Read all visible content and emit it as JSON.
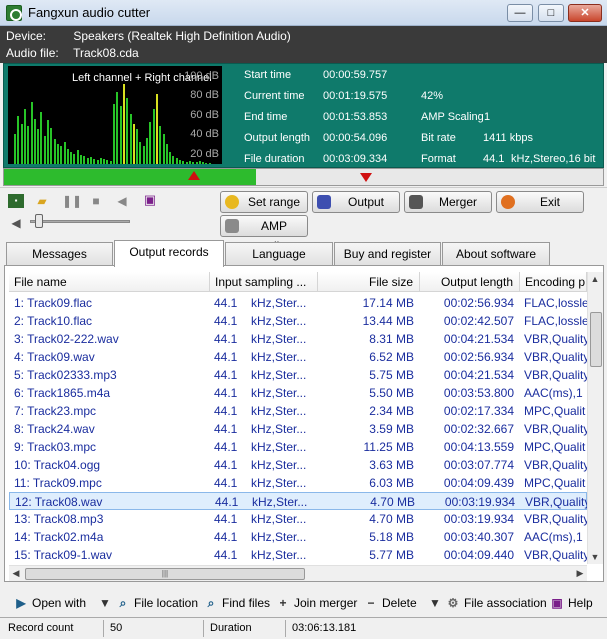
{
  "window": {
    "title": "Fangxun audio cutter",
    "minimize": "—",
    "maximize": "□",
    "close": "✕"
  },
  "info": {
    "device_label": "Device:",
    "device_value": "Speakers (Realtek High Definition Audio)",
    "file_label": "Audio file:",
    "file_value": "Track08.cda"
  },
  "viz": {
    "channel_label": "Left channel + Right channel",
    "db_ticks": [
      "100 dB",
      "80 dB",
      "60 dB",
      "40 dB",
      "20 dB"
    ]
  },
  "stats": {
    "start_time_label": "Start time",
    "start_time": "00:00:59.757",
    "current_time_label": "Current time",
    "current_time": "00:01:19.575",
    "percent": "42%",
    "end_time_label": "End time",
    "end_time": "00:01:53.853",
    "amp_scaling_label": "AMP Scaling",
    "amp_scaling": "1",
    "output_length_label": "Output length",
    "output_length": "00:00:54.096",
    "bit_rate_label": "Bit rate",
    "bit_rate": "1411 kbps",
    "file_duration_label": "File duration",
    "file_duration": "00:03:09.334",
    "format_label": "Format",
    "format_rate": "44.1",
    "format_detail": "kHz,Stereo,16 bit"
  },
  "progress": {
    "fraction": 0.42
  },
  "toolbar": {
    "volume": 0.05,
    "set_range": "Set range",
    "output": "Output",
    "merger": "Merger",
    "exit": "Exit",
    "amp_scaling": "AMP scaling"
  },
  "tabs": [
    {
      "label": "Messages"
    },
    {
      "label": "Output records"
    },
    {
      "label": "Language"
    },
    {
      "label": "Buy and register"
    },
    {
      "label": "About software"
    }
  ],
  "columns": [
    "File name",
    "Input sampling ...",
    "File size",
    "Output length",
    "Encoding p"
  ],
  "rows": [
    [
      "1: Track09.flac",
      "44.1",
      "kHz,Ster...",
      "17.14 MB",
      "00:02:56.934",
      "FLAC,lossle"
    ],
    [
      "2: Track10.flac",
      "44.1",
      "kHz,Ster...",
      "13.44 MB",
      "00:02:42.507",
      "FLAC,lossle"
    ],
    [
      "3: Track02-222.wav",
      "44.1",
      "kHz,Ster...",
      "8.31 MB",
      "00:04:21.534",
      "VBR,Quality"
    ],
    [
      "4: Track09.wav",
      "44.1",
      "kHz,Ster...",
      "6.52 MB",
      "00:02:56.934",
      "VBR,Quality"
    ],
    [
      "5: Track02333.mp3",
      "44.1",
      "kHz,Ster...",
      "5.75 MB",
      "00:04:21.534",
      "VBR,Quality"
    ],
    [
      "6: Track1865.m4a",
      "44.1",
      "kHz,Ster...",
      "5.50 MB",
      "00:03:53.800",
      "AAC(ms),1"
    ],
    [
      "7: Track23.mpc",
      "44.1",
      "kHz,Ster...",
      "2.34 MB",
      "00:02:17.334",
      "MPC,Qualit"
    ],
    [
      "8: Track24.wav",
      "44.1",
      "kHz,Ster...",
      "3.59 MB",
      "00:02:32.667",
      "VBR,Quality"
    ],
    [
      "9: Track03.mpc",
      "44.1",
      "kHz,Ster...",
      "11.25 MB",
      "00:04:13.559",
      "MPC,Qualit"
    ],
    [
      "10: Track04.ogg",
      "44.1",
      "kHz,Ster...",
      "3.63 MB",
      "00:03:07.774",
      "VBR,Quality"
    ],
    [
      "11: Track09.mpc",
      "44.1",
      "kHz,Ster...",
      "6.03 MB",
      "00:04:09.439",
      "MPC,Qualit"
    ],
    [
      "12: Track08.wav",
      "44.1",
      "kHz,Ster...",
      "4.70 MB",
      "00:03:19.934",
      "VBR,Quality"
    ],
    [
      "13: Track08.mp3",
      "44.1",
      "kHz,Ster...",
      "4.70 MB",
      "00:03:19.934",
      "VBR,Quality"
    ],
    [
      "14: Track02.m4a",
      "44.1",
      "kHz,Ster...",
      "5.18 MB",
      "00:03:40.307",
      "AAC(ms),1"
    ],
    [
      "15: Track09-1.wav",
      "44.1",
      "kHz,Ster...",
      "5.77 MB",
      "00:04:09.440",
      "VBR,Quality"
    ]
  ],
  "selected_row": 11,
  "bottom": {
    "open_with": "Open with",
    "file_location": "File location",
    "find_files": "Find files",
    "join_merger": "Join merger",
    "delete": "Delete",
    "file_association": "File association",
    "help": "Help"
  },
  "status": {
    "record_count_label": "Record count",
    "record_count": "50",
    "duration_label": "Duration",
    "duration": "03:06:13.181"
  },
  "colors": {
    "accent": "#0f7a6b",
    "progress": "#2dbb2d",
    "list_text": "#1a2d9e"
  }
}
